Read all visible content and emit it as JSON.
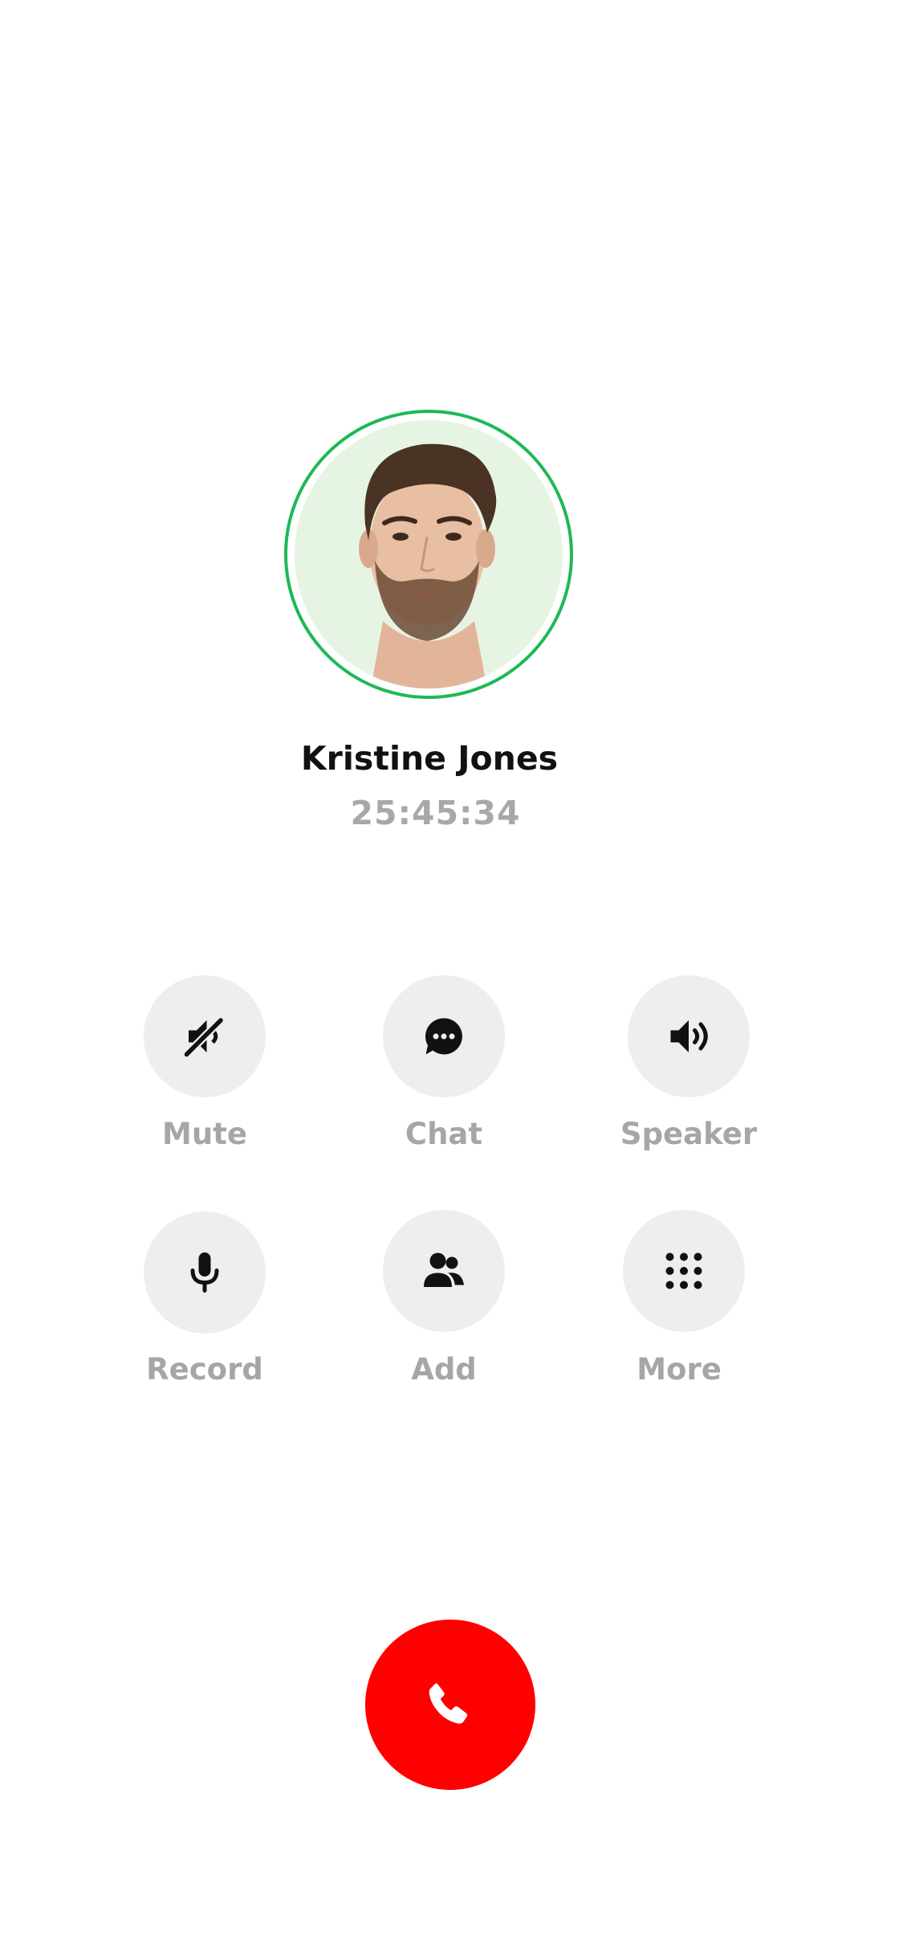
{
  "caller": {
    "name": "Kristine Jones",
    "timer": "25:45:34",
    "ring_color": "#1db954"
  },
  "controls": [
    {
      "label": "Mute",
      "icon": "mute-icon"
    },
    {
      "label": "Chat",
      "icon": "chat-icon"
    },
    {
      "label": "Speaker",
      "icon": "speaker-icon"
    },
    {
      "label": "Record",
      "icon": "microphone-icon"
    },
    {
      "label": "Add",
      "icon": "add-people-icon"
    },
    {
      "label": "More",
      "icon": "keypad-icon"
    }
  ],
  "end_call": {
    "icon": "phone-icon",
    "color": "#ff0000"
  }
}
